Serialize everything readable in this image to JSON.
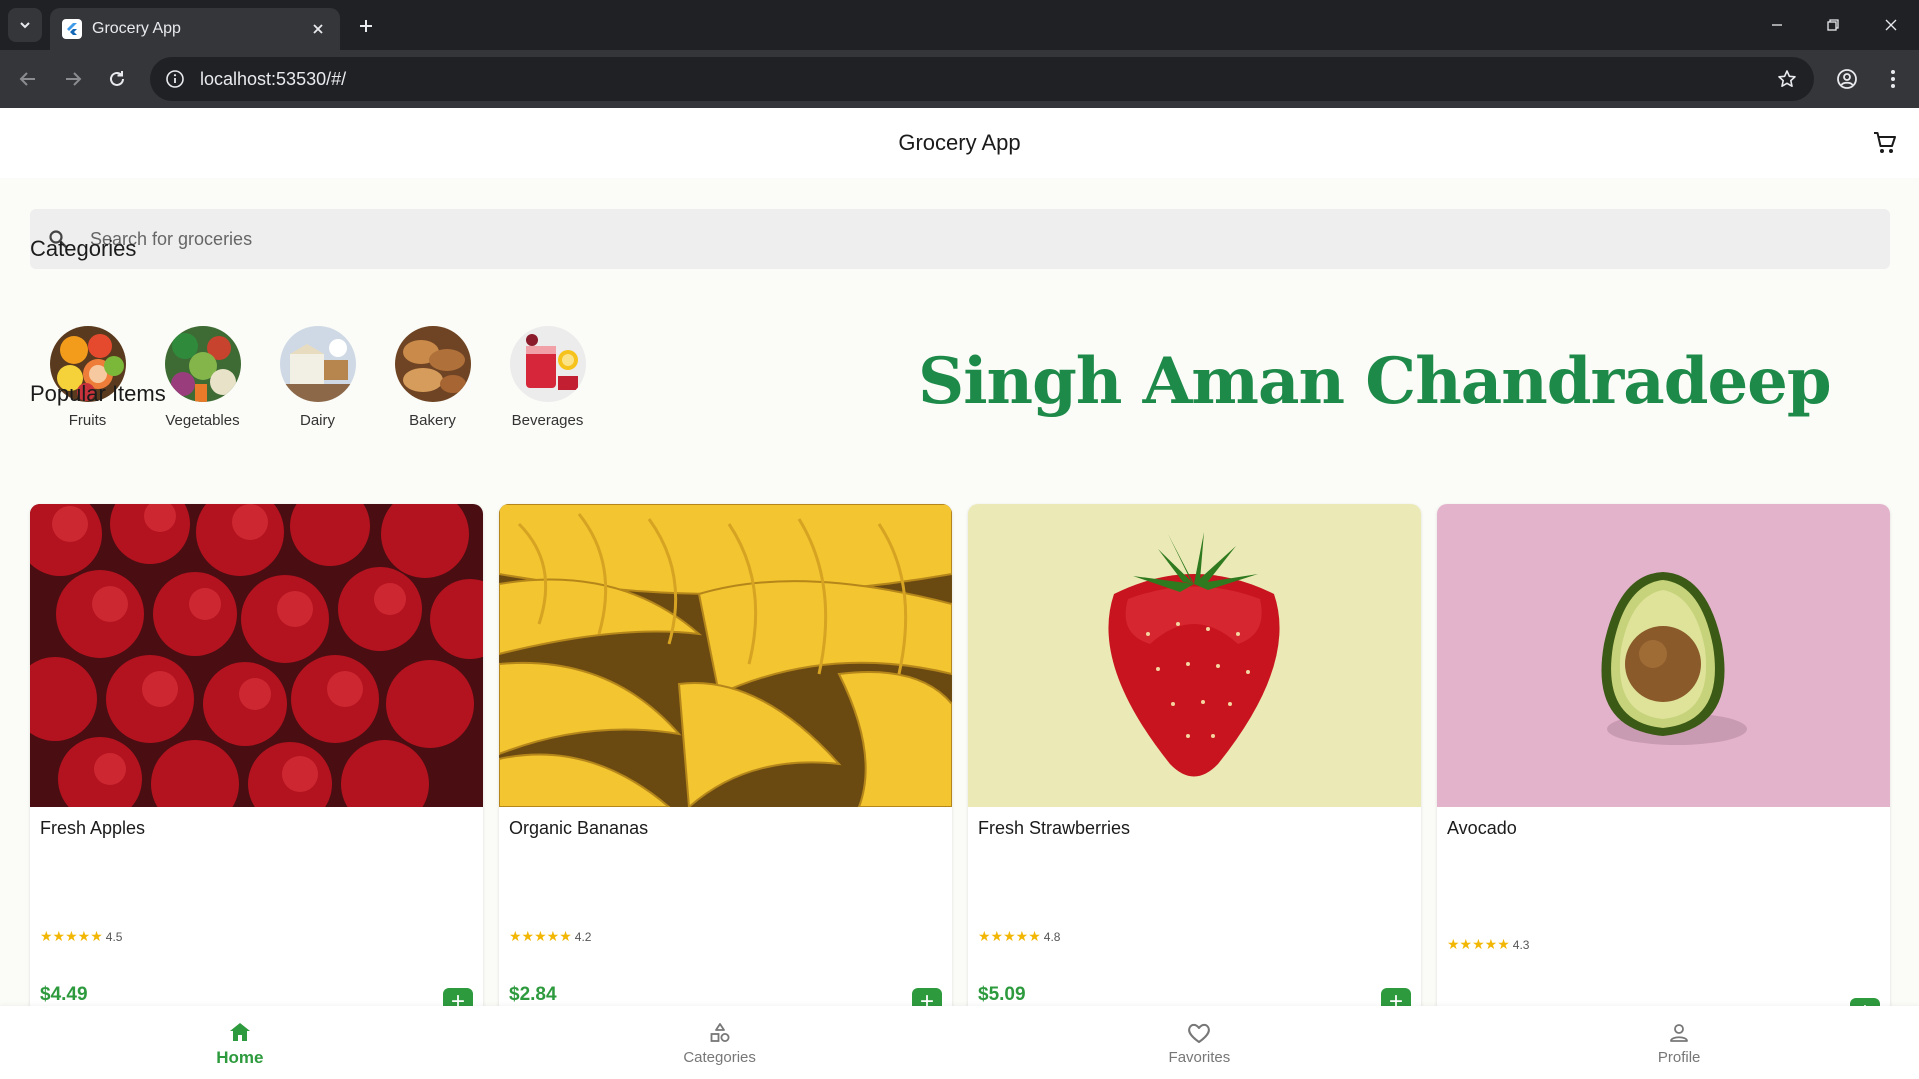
{
  "browser": {
    "tab_title": "Grocery App",
    "url": "localhost:53530/#/"
  },
  "app": {
    "title": "Grocery App",
    "search": {
      "placeholder": "Search for groceries"
    },
    "categories_heading": "Categories",
    "categories": [
      {
        "label": "Fruits"
      },
      {
        "label": "Vegetables"
      },
      {
        "label": "Dairy"
      },
      {
        "label": "Bakery"
      },
      {
        "label": "Beverages"
      }
    ],
    "watermark": "Singh Aman Chandradeep",
    "popular_heading": "Popular Items",
    "products": [
      {
        "name": "Fresh Apples",
        "rating": "4.5",
        "stars": "★★★★★",
        "price": "$4.49"
      },
      {
        "name": "Organic Bananas",
        "rating": "4.2",
        "stars": "★★★★★",
        "price": "$2.84"
      },
      {
        "name": "Fresh Strawberries",
        "rating": "4.8",
        "stars": "★★★★★",
        "price": "$5.09"
      },
      {
        "name": "Avocado",
        "rating": "4.3",
        "stars": "★★★★★",
        "price": ""
      }
    ],
    "add_label": "+",
    "bottom_nav": [
      {
        "label": "Home",
        "icon": "home-icon",
        "active": true
      },
      {
        "label": "Categories",
        "icon": "shapes-icon",
        "active": false
      },
      {
        "label": "Favorites",
        "icon": "heart-icon",
        "active": false
      },
      {
        "label": "Profile",
        "icon": "person-icon",
        "active": false
      }
    ]
  },
  "colors": {
    "accent": "#2e9a3e",
    "watermark": "#1e8a4a",
    "star": "#f2b705",
    "browser_frame": "#202124"
  }
}
